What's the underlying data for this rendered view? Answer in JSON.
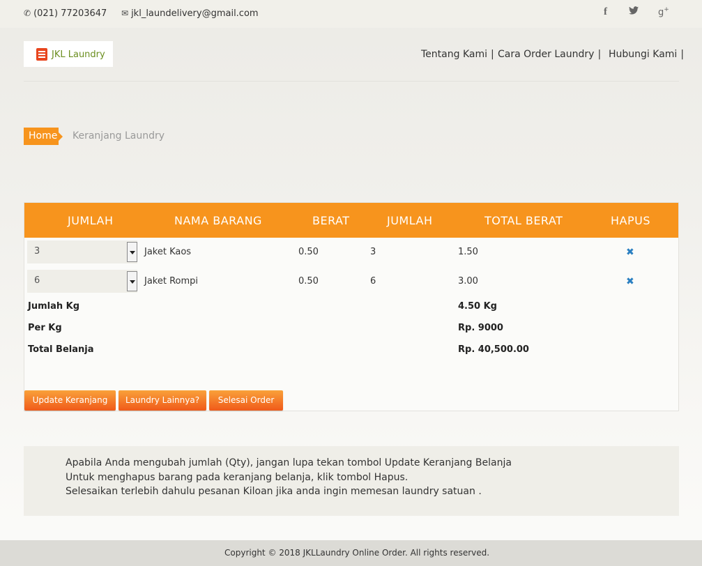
{
  "topbar": {
    "phone": "(021) 77203647",
    "phone_icon": "phone-icon",
    "email": "jkl_laundelivery@gmail.com",
    "email_icon": "envelope-icon",
    "social": {
      "facebook": "f",
      "twitter": "🐦",
      "googleplus": "g"
    }
  },
  "header": {
    "logo_text": "JKL Laundry",
    "nav": [
      {
        "label": "Tentang Kami",
        "sep": "|"
      },
      {
        "label": "Cara Order Laundry",
        "sep": "|"
      },
      {
        "label": "Hubungi Kami",
        "sep": "|"
      }
    ]
  },
  "breadcrumb": {
    "home": "Home",
    "current": "Keranjang Laundry"
  },
  "cart": {
    "accent_color": "#f7941d",
    "columns": [
      "JUMLAH",
      "NAMA BARANG",
      "BERAT",
      "JUMLAH",
      "TOTAL BERAT",
      "HAPUS"
    ],
    "rows": [
      {
        "qty": "3",
        "name": "Jaket Kaos",
        "berat": "0.50",
        "jumlah": "3",
        "total": "1.50",
        "delete_icon": "✖"
      },
      {
        "qty": "6",
        "name": "Jaket Rompi",
        "berat": "0.50",
        "jumlah": "6",
        "total": "3.00",
        "delete_icon": "✖"
      }
    ],
    "summary": [
      {
        "label": "Jumlah Kg",
        "value": "4.50 Kg"
      },
      {
        "label": "Per Kg",
        "value": "Rp. 9000"
      },
      {
        "label": "Total Belanja",
        "value": "Rp. 40,500.00"
      }
    ],
    "buttons": {
      "update": "Update Keranjang",
      "more": "Laundry Lainnya?",
      "finish": "Selesai Order"
    }
  },
  "info": {
    "lines": [
      "Apabila Anda mengubah jumlah (Qty), jangan lupa tekan tombol Update Keranjang Belanja",
      "Untuk menghapus barang pada keranjang belanja, klik tombol Hapus.",
      "Selesaikan terlebih dahulu pesanan Kiloan jika anda ingin memesan laundry satuan ."
    ]
  },
  "footer": {
    "copyright": "Copyright © 2018 JKLLaundry Online Order. All rights reserved."
  }
}
